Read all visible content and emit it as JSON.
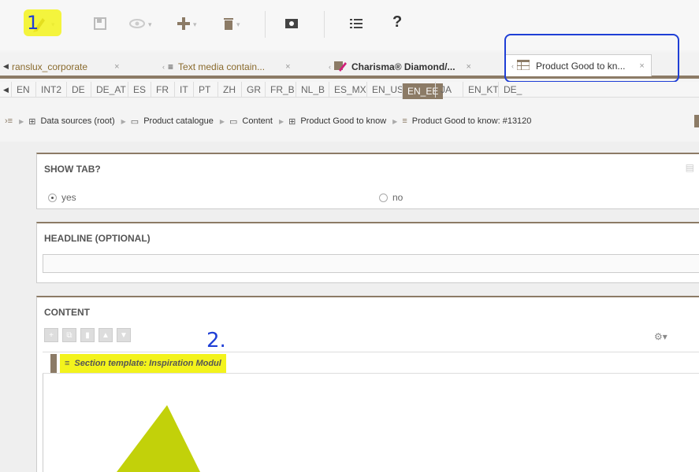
{
  "toolbar": {
    "items": [
      {
        "name": "edit-icon"
      },
      {
        "name": "save-icon"
      },
      {
        "name": "preview-icon"
      },
      {
        "name": "add-icon"
      },
      {
        "name": "delete-icon"
      },
      {
        "name": "screen-icon"
      },
      {
        "name": "list-icon"
      }
    ],
    "help_label": "?"
  },
  "tabs": [
    {
      "label": "ranslux_corporate"
    },
    {
      "label": "Text media contain..."
    },
    {
      "label": "Charisma® Diamond/..."
    },
    {
      "label": "Product Good to kn..."
    }
  ],
  "languages": [
    "EN",
    "INT2",
    "DE",
    "DE_AT",
    "ES",
    "FR",
    "IT",
    "PT",
    "ZH",
    "GR",
    "FR_B",
    "NL_B",
    "ES_MX",
    "EN_US",
    "EN_EE",
    "JA",
    "EN_KT",
    "DE_"
  ],
  "active_language": "EN_EE",
  "breadcrumb": [
    {
      "label": "Data sources (root)",
      "icon": "table-icon"
    },
    {
      "label": "Product catalogue",
      "icon": "folder-icon"
    },
    {
      "label": "Content",
      "icon": "folder-icon"
    },
    {
      "label": "Product Good to know",
      "icon": "table-icon"
    },
    {
      "label": "Product Good to know: #13120",
      "icon": "record-icon"
    }
  ],
  "sections": {
    "show_tab": {
      "title": "SHOW TAB?",
      "yes": "yes",
      "no": "no",
      "selected": "yes"
    },
    "headline": {
      "title": "HEADLINE (OPTIONAL)",
      "value": ""
    },
    "content": {
      "title": "CONTENT",
      "section_template": "Section template: Inspiration Modul"
    }
  },
  "annotations": {
    "one": "1",
    "two": "2."
  },
  "colors": {
    "accent": "#8c7b66",
    "highlight": "#f3f31c",
    "annotation_blue": "#1f3fd6",
    "annotation_green": "#c2d10a"
  }
}
